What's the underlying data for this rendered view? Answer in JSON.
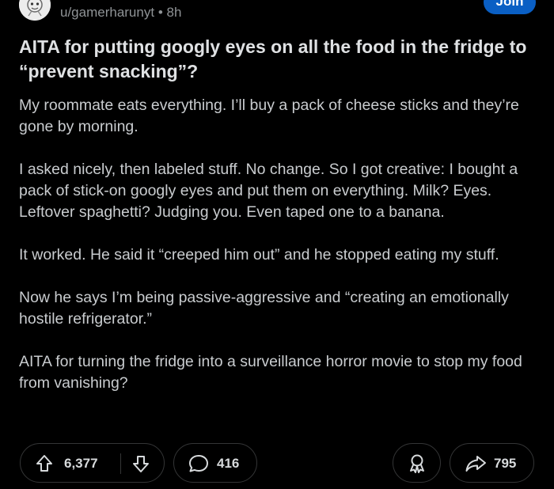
{
  "post": {
    "author": "u/gamerharunyt",
    "separator": "•",
    "age": "8h",
    "join_label": "Join",
    "title": "AITA for putting googly eyes on all the food in the fridge to “prevent snacking”?",
    "paragraphs": [
      "My roommate eats everything. I’ll buy a pack of cheese sticks and they’re gone by morning.",
      "I asked nicely, then labeled stuff. No change. So I got creative: I bought a pack of stick-on googly eyes and put them on everything. Milk? Eyes. Leftover spaghetti? Judging you. Even taped one to a banana.",
      "It worked. He said it “creeped him out” and he stopped eating my stuff.",
      "Now he says I’m being passive-aggressive and “creating an emotionally hostile refrigerator.”",
      "AITA for turning the fridge into a surveillance horror movie to stop my food from vanishing?"
    ]
  },
  "actions": {
    "upvotes": "6,377",
    "comments": "416",
    "shares": "795"
  },
  "icons": {
    "upvote": "arrow-up-icon",
    "downvote": "arrow-down-icon",
    "comment": "comment-bubble-icon",
    "award": "award-icon",
    "share": "share-arrow-icon"
  },
  "colors": {
    "background": "#000000",
    "join_button": "#0a5fc4",
    "meta_text": "#8f9396",
    "body_text": "#c9cccf"
  }
}
